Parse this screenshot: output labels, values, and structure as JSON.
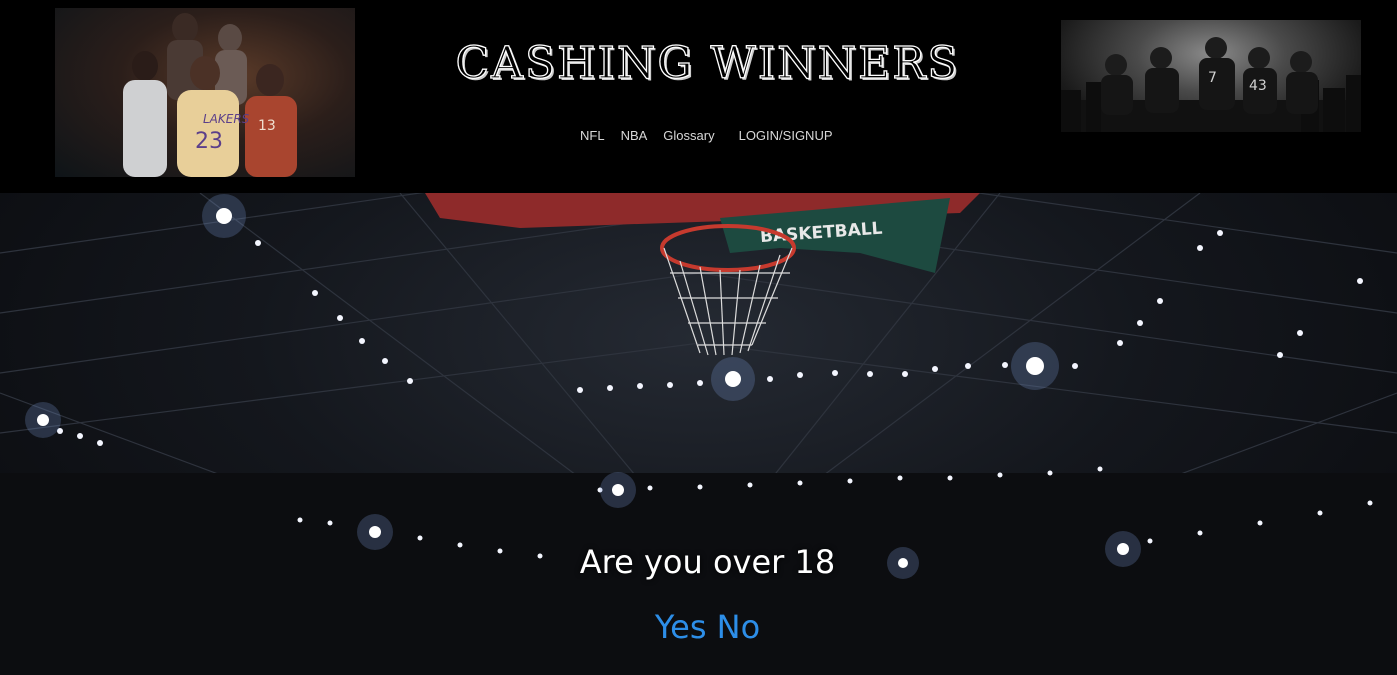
{
  "header": {
    "title": "CASHING WINNERS",
    "nav": [
      {
        "label": "NFL"
      },
      {
        "label": "NBA"
      },
      {
        "label": "Glossary"
      },
      {
        "label": "LOGIN/SIGNUP"
      }
    ],
    "left_banner_jersey_numbers": [
      "23",
      "13"
    ],
    "left_banner_team_text": "LAKERS",
    "right_banner_jersey_numbers": [
      "7",
      "43"
    ]
  },
  "hero": {
    "backboard_text": "BASKETBALL",
    "question": "Are you over 18",
    "answers": {
      "yes": "Yes",
      "no": "No"
    }
  },
  "colors": {
    "background": "#000000",
    "link_blue": "#2d8ee8",
    "nav_text": "#d8d8d8"
  }
}
